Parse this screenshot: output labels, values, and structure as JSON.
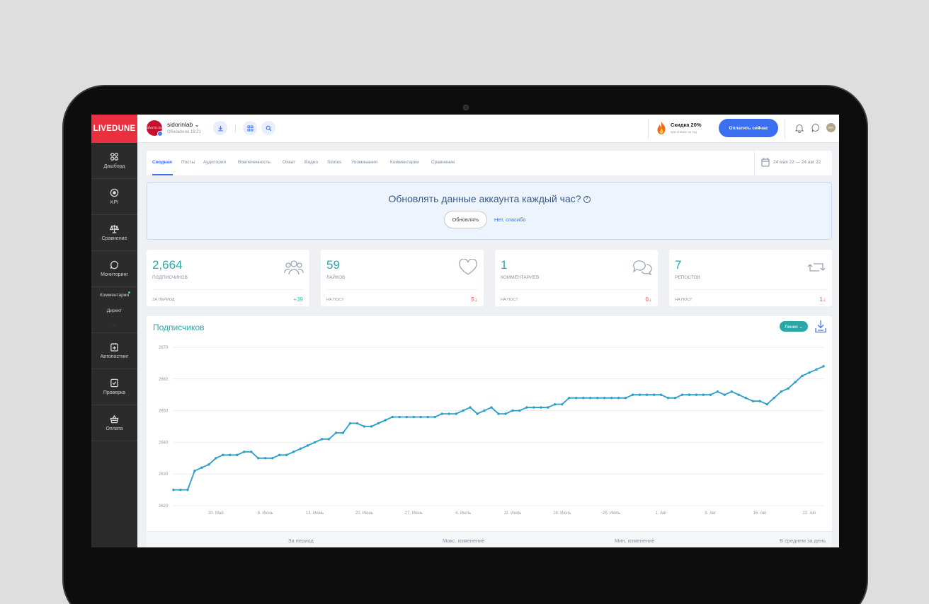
{
  "sidebar": {
    "logo": "LIVEDUNE",
    "items": [
      {
        "label": "Дашборд",
        "icon": "dashboard-icon"
      },
      {
        "label": "KPI",
        "icon": "target-icon"
      },
      {
        "label": "Сравнение",
        "icon": "scales-icon"
      },
      {
        "label": "Мониторинг",
        "icon": "chat-bubble-icon"
      }
    ],
    "sub_items": [
      "Комментарии",
      "Директ"
    ],
    "more": "...",
    "items2": [
      {
        "label": "Автопостинг",
        "icon": "calendar-plus-icon"
      },
      {
        "label": "Проверка",
        "icon": "shield-check-icon"
      },
      {
        "label": "Оплата",
        "icon": "basket-icon"
      }
    ]
  },
  "header": {
    "avatar_text": "sidorin.lab",
    "account_name": "sidorinlab ⌄",
    "updated": "Обновлено 19:21",
    "promo_title": "Скидка 20%",
    "promo_sub": "при оплате за год",
    "pay_button": "Оплатить сейчас",
    "user_initials": "МА"
  },
  "tabs": [
    "Сводная",
    "Посты",
    "Аудитория",
    "Вовлеченность",
    "Охват",
    "Видео",
    "Stories",
    "Упоминания",
    "Комментарии",
    "Сравнение"
  ],
  "date_range": "24 мая 22 — 24 авг 22",
  "banner": {
    "title": "Обновлять данные аккаунта каждый час?",
    "update_button": "Обновлять",
    "decline_link": "Нет, спасибо"
  },
  "cards": [
    {
      "value": "2,664",
      "label": "ПОДПИСЧИКОВ",
      "footer": "ЗА ПЕРИОД",
      "delta": "+39",
      "delta_dir": "up"
    },
    {
      "value": "59",
      "label": "ЛАЙКОВ",
      "footer": "НА ПОСТ",
      "delta": "5↓",
      "delta_dir": "down"
    },
    {
      "value": "1",
      "label": "КОММЕНТАРИЕВ",
      "footer": "НА ПОСТ",
      "delta": "0↓",
      "delta_dir": "down"
    },
    {
      "value": "7",
      "label": "РЕПОСТОВ",
      "footer": "НА ПОСТ",
      "delta": "1↓",
      "delta_dir": "down"
    }
  ],
  "chart": {
    "title": "Подписчиков",
    "type_button": "Линия ⌄",
    "stats": [
      "За период",
      "Макс. изменение",
      "Мин. изменение",
      "В среднем за день"
    ]
  },
  "chart_data": {
    "type": "line",
    "title": "Подписчиков",
    "ylim": [
      2620,
      2670
    ],
    "yticks": [
      2620,
      2630,
      2640,
      2650,
      2660,
      2670
    ],
    "xticks": [
      "30. Май",
      "6. Июнь",
      "13. Июнь",
      "20. Июнь",
      "27. Июнь",
      "4. Июль",
      "11. Июль",
      "18. Июль",
      "25. Июль",
      "1. Авг",
      "8. Авг",
      "15. Авг",
      "22. Авг"
    ],
    "x_start": "24 мая 22",
    "grid": true,
    "color": "#2b9ec7",
    "values": [
      2625,
      2625,
      2625,
      2631,
      2632,
      2633,
      2635,
      2636,
      2636,
      2636,
      2637,
      2637,
      2635,
      2635,
      2635,
      2636,
      2636,
      2637,
      2638,
      2639,
      2640,
      2641,
      2641,
      2643,
      2643,
      2646,
      2646,
      2645,
      2645,
      2646,
      2647,
      2648,
      2648,
      2648,
      2648,
      2648,
      2648,
      2648,
      2649,
      2649,
      2649,
      2650,
      2651,
      2649,
      2650,
      2651,
      2649,
      2649,
      2650,
      2650,
      2651,
      2651,
      2651,
      2651,
      2652,
      2652,
      2654,
      2654,
      2654,
      2654,
      2654,
      2654,
      2654,
      2654,
      2654,
      2655,
      2655,
      2655,
      2655,
      2655,
      2654,
      2654,
      2655,
      2655,
      2655,
      2655,
      2655,
      2656,
      2655,
      2656,
      2655,
      2654,
      2653,
      2653,
      2652,
      2654,
      2656,
      2657,
      2659,
      2661,
      2662,
      2663,
      2664
    ]
  }
}
